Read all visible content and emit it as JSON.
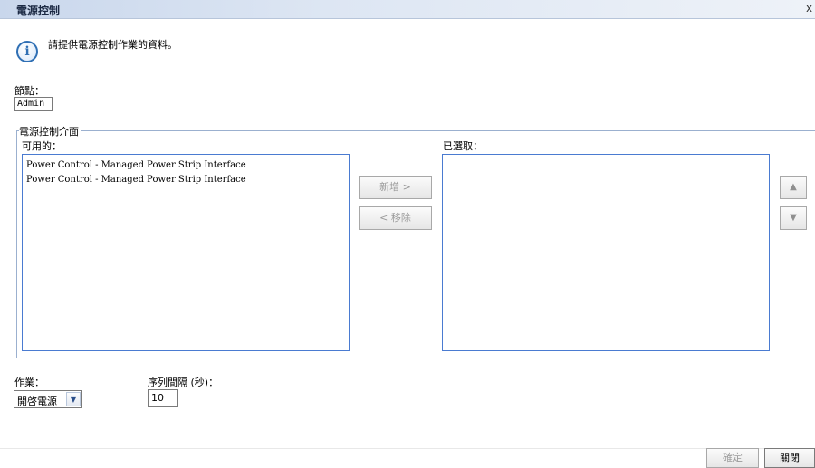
{
  "window": {
    "title": "電源控制",
    "close_label": "x"
  },
  "info": {
    "message": "請提供電源控制作業的資料。",
    "icon": "info-icon"
  },
  "node": {
    "label": "節點：",
    "value": "Admin"
  },
  "power_interface": {
    "group_title": "電源控制介面",
    "available_label": "可用的：",
    "selected_label": "已選取：",
    "available_items": [
      "Power Control - Managed Power Strip Interface",
      "Power Control - Managed Power Strip Interface"
    ],
    "selected_items": [],
    "add_label": "新增 >",
    "remove_label": "< 移除",
    "move_up_icon": "triangle-up-icon",
    "move_down_icon": "triangle-down-icon"
  },
  "operation": {
    "label": "作業：",
    "value": "開啓電源"
  },
  "interval": {
    "label": "序列間隔 (秒)：",
    "value": "10"
  },
  "buttons": {
    "ok_label": "確定",
    "close_label": "關閉"
  }
}
